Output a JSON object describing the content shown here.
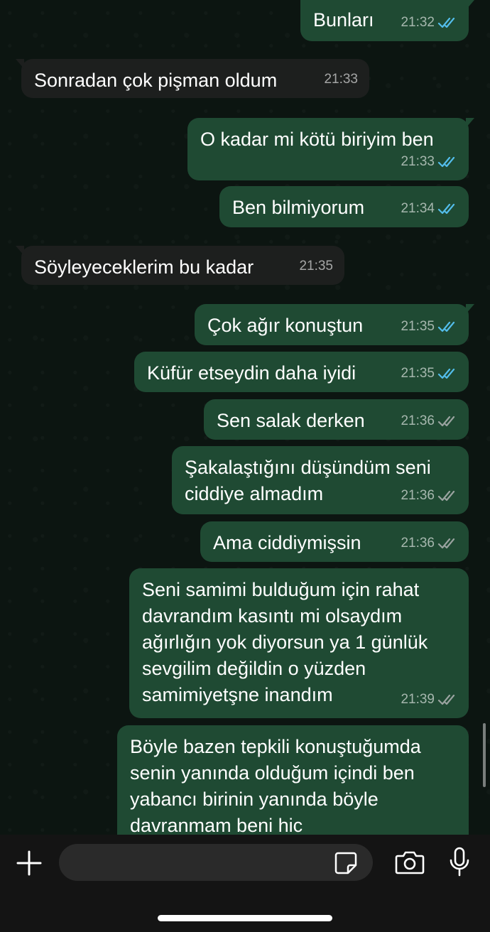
{
  "colors": {
    "outgoing_bubble": "#1f4a33",
    "incoming_bubble": "#1d1f1e",
    "read_tick": "#53bdeb",
    "delivered_tick": "#9aa3a0"
  },
  "messages": [
    {
      "text": "Bunları",
      "time": "21:32",
      "direction": "outgoing",
      "status": "read"
    },
    {
      "text": "Sonradan çok pişman oldum",
      "time": "21:33",
      "direction": "incoming"
    },
    {
      "text": "O kadar mi kötü biriyim ben",
      "time": "21:33",
      "direction": "outgoing",
      "status": "read"
    },
    {
      "text": "Ben bilmiyorum",
      "time": "21:34",
      "direction": "outgoing",
      "status": "read"
    },
    {
      "text": "Söyleyeceklerim bu kadar",
      "time": "21:35",
      "direction": "incoming"
    },
    {
      "text": "Çok ağır konuştun",
      "time": "21:35",
      "direction": "outgoing",
      "status": "read"
    },
    {
      "text": "Küfür etseydin daha iyidi",
      "time": "21:35",
      "direction": "outgoing",
      "status": "read"
    },
    {
      "text": "Sen salak derken",
      "time": "21:36",
      "direction": "outgoing",
      "status": "delivered"
    },
    {
      "text": "Şakalaştığını düşündüm seni\nciddiye almadım",
      "time": "21:36",
      "direction": "outgoing",
      "status": "delivered"
    },
    {
      "text": "Ama ciddiymişsin",
      "time": "21:36",
      "direction": "outgoing",
      "status": "delivered"
    },
    {
      "text": "Seni samimi bulduğum için rahat\ndavrandım kasıntı mi olsaydım\nağırlığın yok diyorsun ya 1 günlük\nsevgilim değildin o yüzden\nsamimiyetşne inandım",
      "time": "21:39",
      "direction": "outgoing",
      "status": "delivered"
    },
    {
      "text": "Böyle bazen tepkili konuştuğumda\nsenin yanında olduğum içindi ben\nyabancı birinin yanında böyle\ndavranmam beni hic",
      "time": "",
      "direction": "outgoing",
      "status": ""
    }
  ],
  "composer": {
    "placeholder": "",
    "icons": [
      "plus-icon",
      "sticker-icon",
      "camera-icon",
      "microphone-icon"
    ]
  }
}
